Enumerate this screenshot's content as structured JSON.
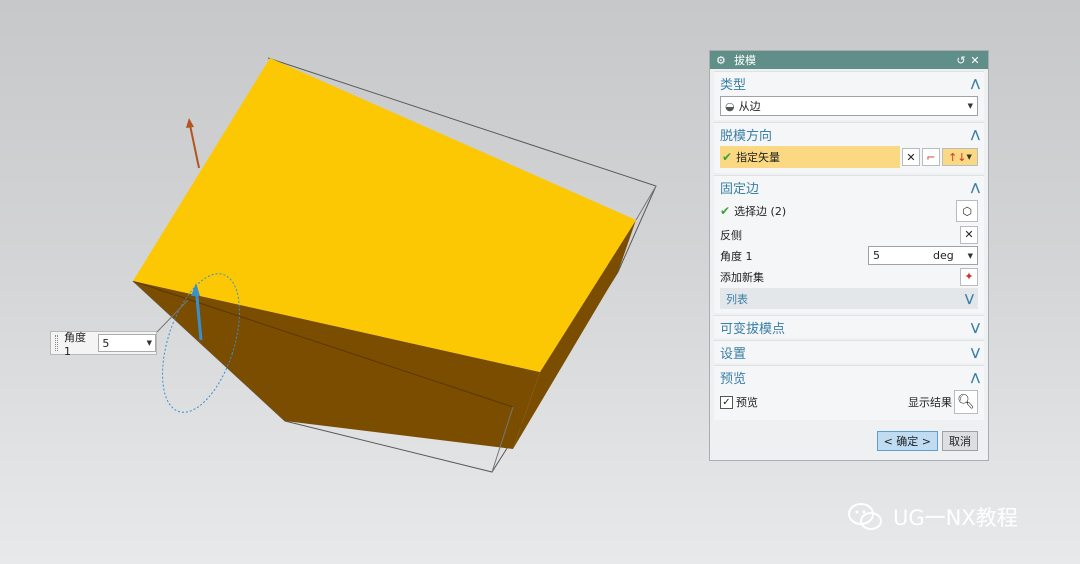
{
  "viewport": {
    "face_top_color": "#fcc804",
    "face_side_color": "#7a4d00",
    "direction_arrow_color": "#b4541e",
    "angle_handle_color": "#3a8fd0"
  },
  "angle_float": {
    "label": "角度 1",
    "value": "5"
  },
  "dialog": {
    "title": "拔模",
    "reset_icon": "↺",
    "close_icon": "✕",
    "sections": {
      "type": {
        "header": "类型",
        "value": "从边"
      },
      "draw_direction": {
        "header": "脱模方向",
        "label": "指定矢量"
      },
      "fixed_edge": {
        "header": "固定边",
        "select_edge": "选择边 (2)",
        "reverse_side": "反侧",
        "angle_label": "角度 1",
        "angle_value": "5",
        "angle_unit": "deg",
        "add_set": "添加新集",
        "list": "列表"
      },
      "variable_points": {
        "header": "可变拔模点"
      },
      "settings": {
        "header": "设置"
      },
      "preview": {
        "header": "预览",
        "checkbox_label": "预览",
        "checked": true,
        "show_result": "显示结果"
      }
    },
    "ok": "< 确定 >",
    "cancel": "取消"
  },
  "watermark": "UG一NX教程"
}
